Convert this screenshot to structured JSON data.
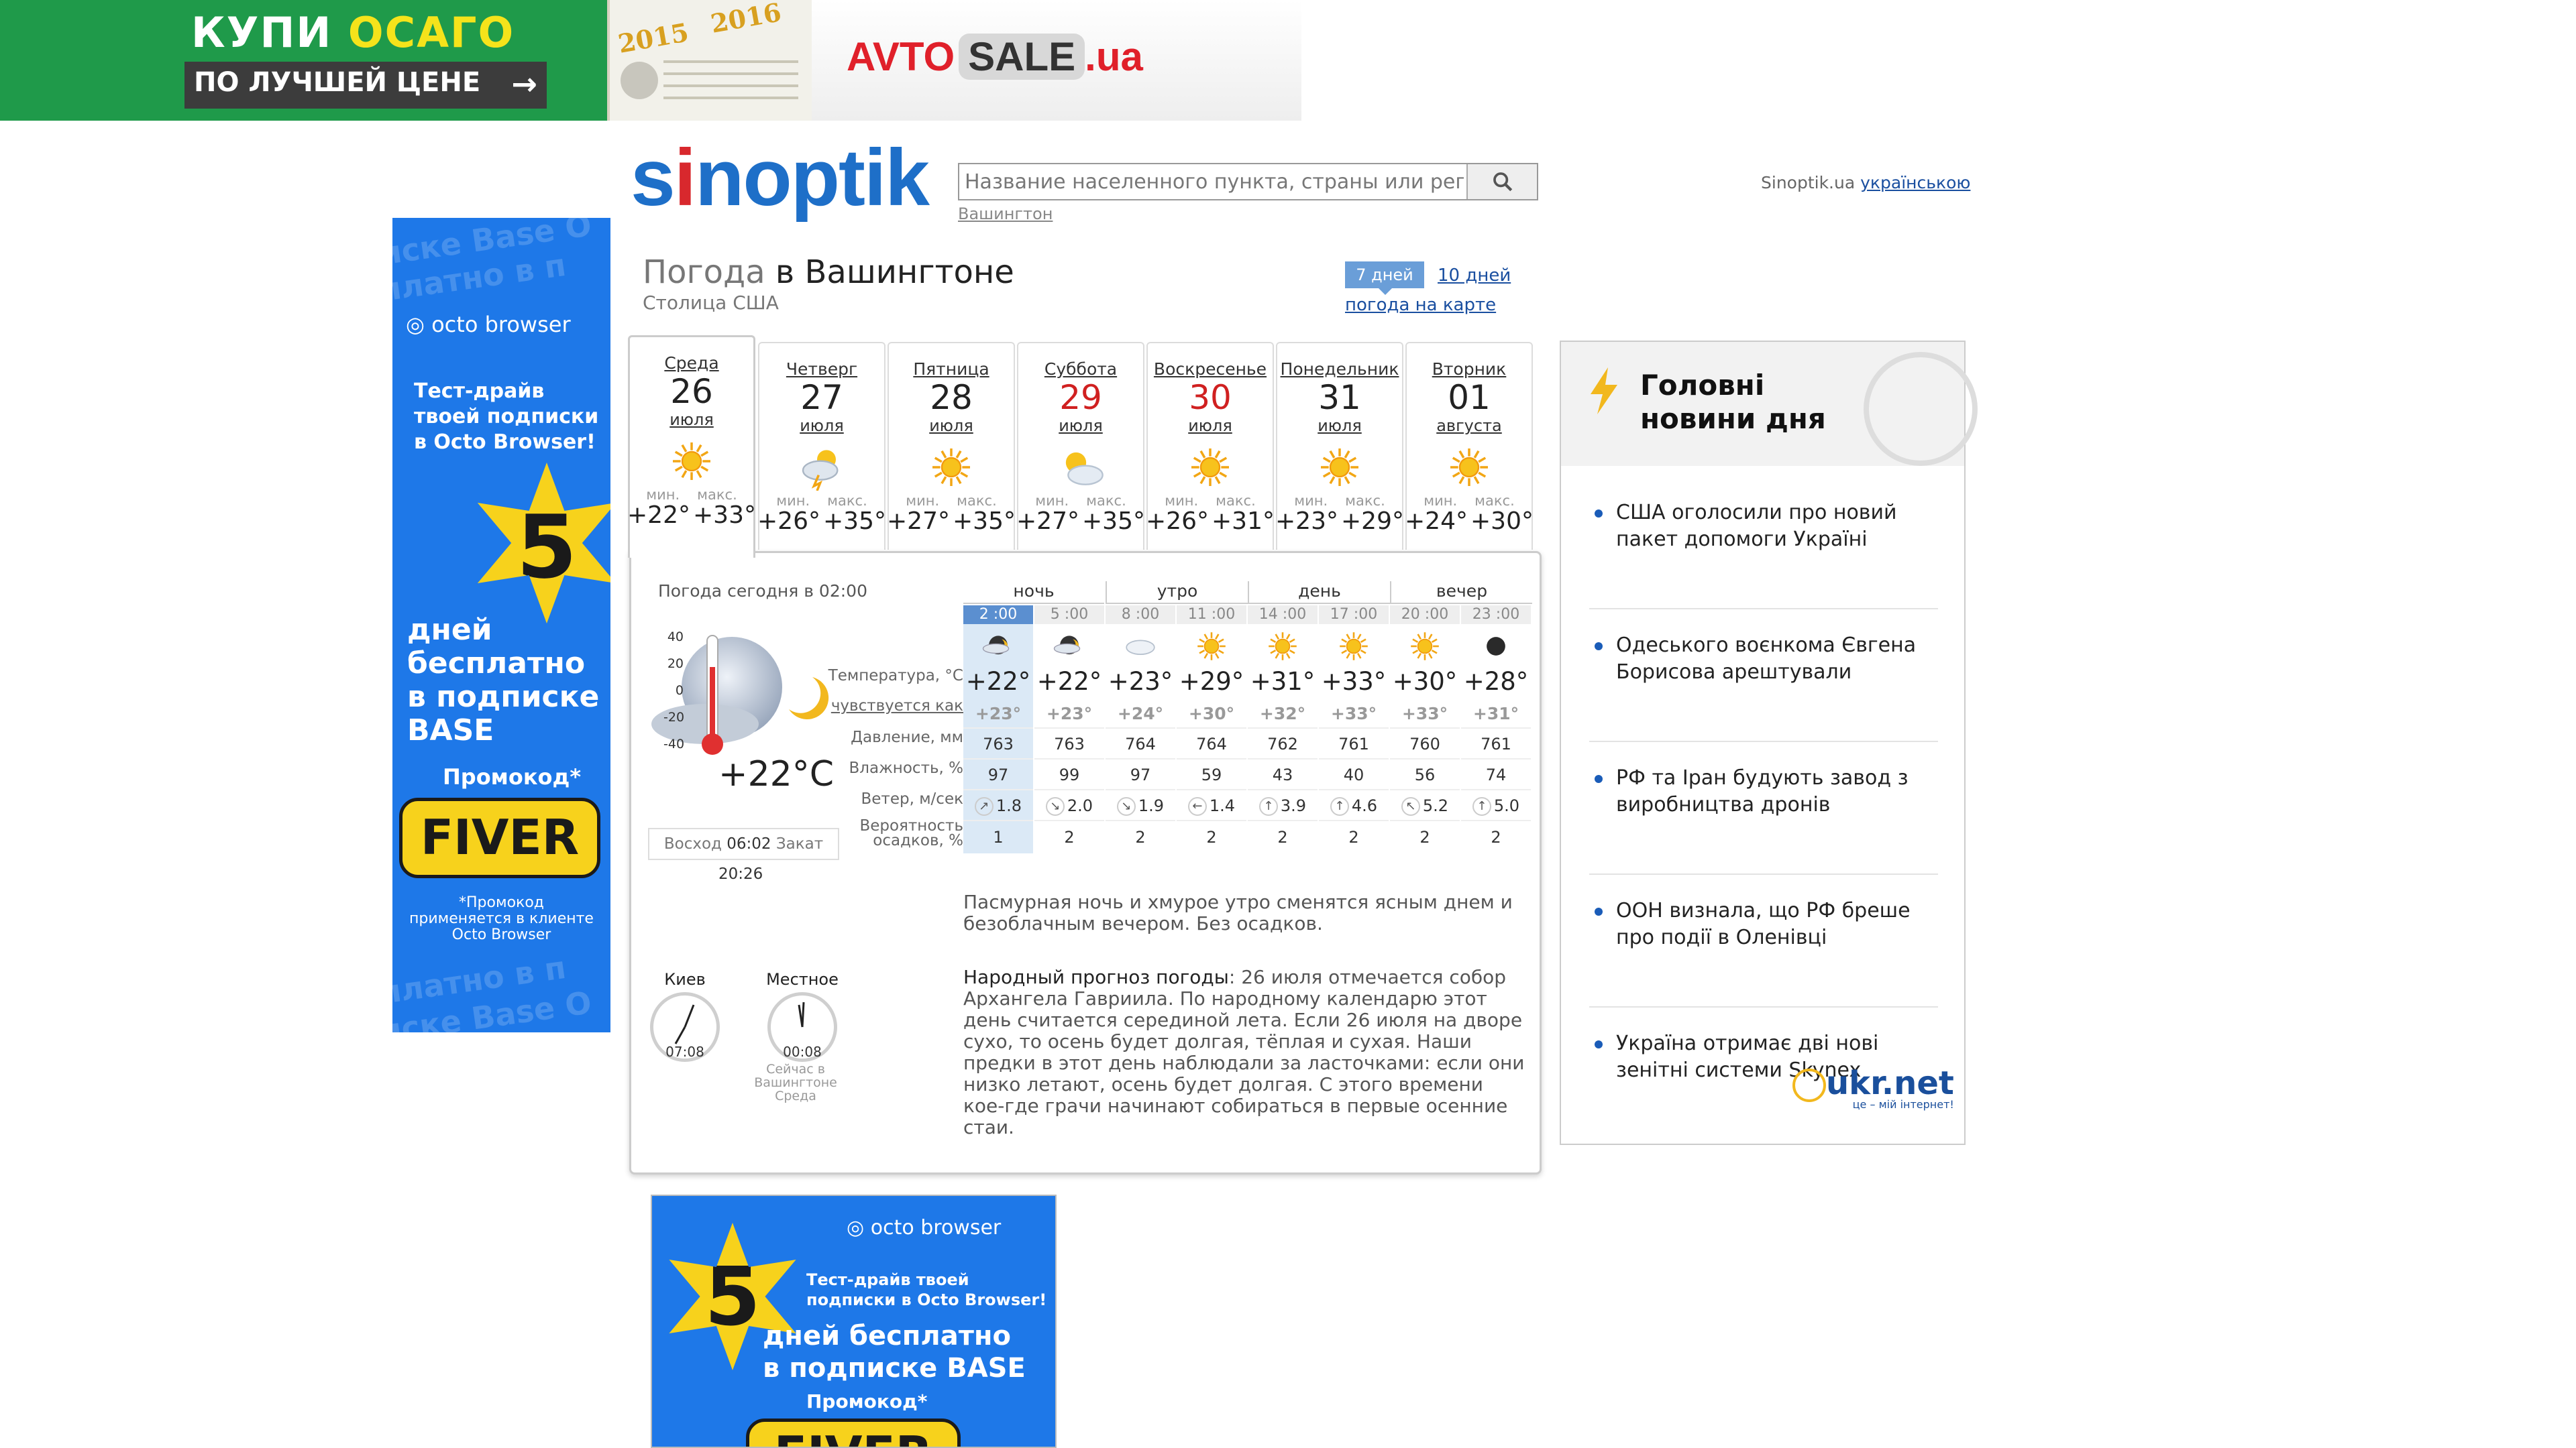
{
  "top_banner": {
    "buy_text": "КУПИ",
    "osago_text": "ОСАГО",
    "best_price_text": "ПО ЛУЧШЕЙ ЦЕНЕ",
    "year_left": "2015",
    "year_right": "2016",
    "brand_logo": "AVTO",
    "brand_sale": "SALE",
    "brand_domain": ".ua"
  },
  "header": {
    "logo_left": "s",
    "logo_mid": "i",
    "logo_right": "noptik",
    "search_placeholder": "Название населенного пункта, страны или региона",
    "breadcrumb": "Вашингтон",
    "site_name": "Sinoptik.ua",
    "lang_link": "українською"
  },
  "left_ad": {
    "brand": "octo browser",
    "line1": "Тест-драйв",
    "line2": "твоей подписки",
    "line3": "в Octo Browser!",
    "number": "5",
    "days1": "дней",
    "days2": "бесплатно",
    "days3": "в подписке",
    "days4": "BASE",
    "promo_label": "Промокод*",
    "promo_code": "FIVER",
    "note1": "*Промокод",
    "note2": "применяется в клиенте",
    "note3": "Octo Browser",
    "watermark1": "иске Base О",
    "watermark2": "платно в п"
  },
  "title": {
    "prefix": "Погода",
    "city": "в Вашингтоне",
    "subtitle": "Столица США",
    "tab_7": "7 дней",
    "tab_10": "10 дней",
    "map_link": "погода на карте"
  },
  "days": [
    {
      "name": "Среда",
      "date": "26",
      "month": "июля",
      "icon": "sun-icon",
      "min_label": "мин.",
      "max_label": "макс.",
      "min": "+22°",
      "max": "+33°",
      "weekend": false
    },
    {
      "name": "Четверг",
      "date": "27",
      "month": "июля",
      "icon": "storm-sun-icon",
      "min_label": "мин.",
      "max_label": "макс.",
      "min": "+26°",
      "max": "+35°",
      "weekend": false
    },
    {
      "name": "Пятница",
      "date": "28",
      "month": "июля",
      "icon": "sun-icon",
      "min_label": "мин.",
      "max_label": "макс.",
      "min": "+27°",
      "max": "+35°",
      "weekend": false
    },
    {
      "name": "Суббота",
      "date": "29",
      "month": "июля",
      "icon": "cloud-sun-icon",
      "min_label": "мин.",
      "max_label": "макс.",
      "min": "+27°",
      "max": "+35°",
      "weekend": true
    },
    {
      "name": "Воскресенье",
      "date": "30",
      "month": "июля",
      "icon": "sun-icon",
      "min_label": "мин.",
      "max_label": "макс.",
      "min": "+26°",
      "max": "+31°",
      "weekend": true
    },
    {
      "name": "Понедельник",
      "date": "31",
      "month": "июля",
      "icon": "sun-icon",
      "min_label": "мин.",
      "max_label": "макс.",
      "min": "+23°",
      "max": "+29°",
      "weekend": false
    },
    {
      "name": "Вторник",
      "date": "01",
      "month": "августа",
      "icon": "sun-icon",
      "min_label": "мин.",
      "max_label": "макс.",
      "min": "+24°",
      "max": "+30°",
      "weekend": false
    }
  ],
  "today": {
    "label": "Погода сегодня в 02:00",
    "scale": [
      "40",
      "20",
      "0",
      "-20",
      "-40"
    ],
    "temp": "+22°C",
    "sunrise_label": "Восход",
    "sunrise": "06:02",
    "sunset_label": "Закат",
    "sunset": "20:26"
  },
  "row_labels": {
    "temp": "Температура, °C",
    "feels": "чувствуется как",
    "pressure": "Давление, мм",
    "humidity": "Влажность, %",
    "wind": "Ветер, м/сек",
    "precip1": "Вероятность",
    "precip2": "осадков, %"
  },
  "periods": [
    "ночь",
    "утро",
    "день",
    "вечер"
  ],
  "hours": [
    {
      "time": "2 :00",
      "icon": "moon-cloud-icon",
      "temp": "+22°",
      "feels": "+23°",
      "pressure": "763",
      "humidity": "97",
      "wind_dir": "↗",
      "wind": "1.8",
      "precip": "1"
    },
    {
      "time": "5 :00",
      "icon": "moon-cloud-icon",
      "temp": "+22°",
      "feels": "+23°",
      "pressure": "763",
      "humidity": "99",
      "wind_dir": "↘",
      "wind": "2.0",
      "precip": "2"
    },
    {
      "time": "8 :00",
      "icon": "cloud-icon",
      "temp": "+23°",
      "feels": "+24°",
      "pressure": "764",
      "humidity": "97",
      "wind_dir": "↘",
      "wind": "1.9",
      "precip": "2"
    },
    {
      "time": "11 :00",
      "icon": "sun-icon",
      "temp": "+29°",
      "feels": "+30°",
      "pressure": "764",
      "humidity": "59",
      "wind_dir": "←",
      "wind": "1.4",
      "precip": "2"
    },
    {
      "time": "14 :00",
      "icon": "sun-icon",
      "temp": "+31°",
      "feels": "+32°",
      "pressure": "762",
      "humidity": "43",
      "wind_dir": "↑",
      "wind": "3.9",
      "precip": "2"
    },
    {
      "time": "17 :00",
      "icon": "sun-icon",
      "temp": "+33°",
      "feels": "+33°",
      "pressure": "761",
      "humidity": "40",
      "wind_dir": "↑",
      "wind": "4.6",
      "precip": "2"
    },
    {
      "time": "20 :00",
      "icon": "sun-icon",
      "temp": "+30°",
      "feels": "+33°",
      "pressure": "760",
      "humidity": "56",
      "wind_dir": "↖",
      "wind": "5.2",
      "precip": "2"
    },
    {
      "time": "23 :00",
      "icon": "moon-icon",
      "temp": "+28°",
      "feels": "+31°",
      "pressure": "761",
      "humidity": "74",
      "wind_dir": "↑",
      "wind": "5.0",
      "precip": "2"
    }
  ],
  "description": "Пасмурная ночь и хмурое утро сменятся ясным днем и безоблачным вечером. Без осадков.",
  "folk": {
    "label": "Народный прогноз погоды",
    "text": ": 26 июля отмечается собор Архангела Гавриила. По народному календарю этот день считается серединой лета. Если 26 июля на дворе сухо, то осень будет долгая, тёплая и сухая. Наши предки в этот день наблюдали за ласточками: если они низко летают, осень будет долгая. С этого времени кое-где грачи начинают собираться в первые осенние стаи."
  },
  "clocks": {
    "kiev_label": "Киев",
    "kiev_time": "07:08",
    "local_label": "Местное",
    "local_time": "00:08",
    "now_line1": "Сейчас в",
    "now_line2": "Вашингтоне",
    "now_line3": "Среда"
  },
  "news": {
    "title1": "Головні",
    "title2": "новини дня",
    "items": [
      "США оголосили про новий пакет допомоги Україні",
      "Одеського воєнкома Євгена Борисова арештували",
      "РФ та Іран будують завод з виробництва дронів",
      "ООН визнала, що РФ бреше про події в Оленівці",
      "Україна отримає дві нові зенітні системи Skynex"
    ],
    "footer_logo": "ukr.net",
    "footer_tagline": "це – мій інтернет!"
  },
  "bottom_ad": {
    "brand": "octo browser",
    "line1": "Тест-драйв твоей",
    "line2": "подписки в Octo Browser!",
    "number": "5",
    "days1": "дней бесплатно",
    "days2": "в подписке BASE",
    "promo_label": "Промокод*",
    "promo_code": "FIVER"
  },
  "colors": {
    "accent_blue": "#1e6fc8",
    "logo_red": "#d8282d",
    "weekend_red": "#d02020",
    "ad_blue": "#1e78e8",
    "ad_yellow": "#f7d21c",
    "selected_hour": "#5b8fd0"
  }
}
